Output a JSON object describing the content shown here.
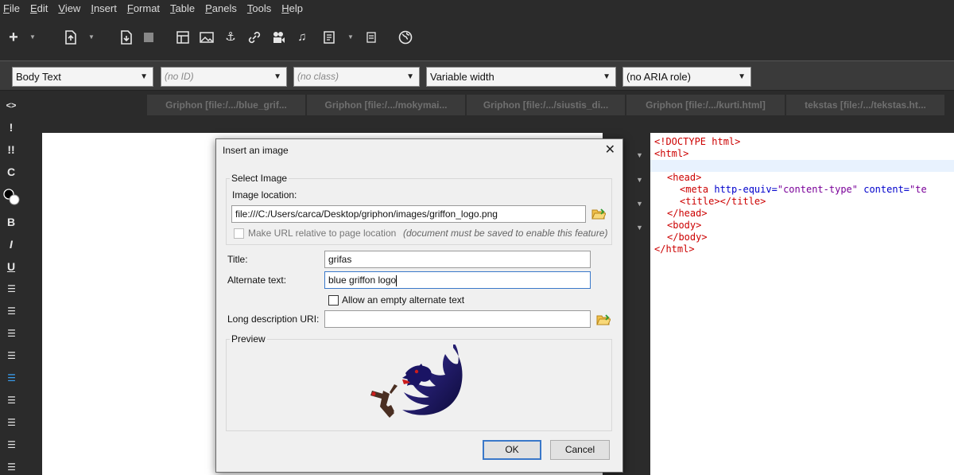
{
  "menu": [
    {
      "label": "File",
      "acc": "F",
      "rest": "ile"
    },
    {
      "label": "Edit",
      "acc": "E",
      "rest": "dit"
    },
    {
      "label": "View",
      "acc": "V",
      "rest": "iew"
    },
    {
      "label": "Insert",
      "acc": "I",
      "rest": "nsert"
    },
    {
      "label": "Format",
      "acc": "F",
      "rest": "ormat"
    },
    {
      "label": "Table",
      "acc": "T",
      "rest": "able"
    },
    {
      "label": "Panels",
      "acc": "P",
      "rest": "anels"
    },
    {
      "label": "Tools",
      "acc": "T",
      "rest": "ools"
    },
    {
      "label": "Help",
      "acc": "H",
      "rest": "elp"
    }
  ],
  "formatbar": {
    "paragraph_style": "Body Text",
    "id": "(no ID)",
    "class": "(no class)",
    "width": "Variable width",
    "aria": "(no ARIA role)"
  },
  "tabs": [
    "Griphon [file:/.../blue_grif...",
    "Griphon [file:/.../mokymai...",
    "Griphon [file:/.../siustis_di...",
    "Griphon [file:/.../kurti.html]",
    "tekstas [file:/.../tekstas.ht..."
  ],
  "source": {
    "doctype": "<!DOCTYPE html>",
    "html_open": "<html>",
    "head_open": "<head>",
    "meta_tag": "<meta",
    "meta_attr1": "http-equiv=",
    "meta_val1": "\"content-type\"",
    "meta_attr2": "content=",
    "meta_val2": "\"te",
    "title_tags": "<title></title>",
    "head_close": "</head>",
    "body_open": "<body>",
    "body_close": "</body>",
    "html_close": "</html>"
  },
  "dialog": {
    "title": "Insert an image",
    "select_image_legend": "Select Image",
    "image_location_label": "Image location:",
    "image_location_value": "file:///C:/Users/carca/Desktop/griphon/images/griffon_logo.png",
    "relative_label": "Make URL relative to page location",
    "relative_note": "(document must be saved to enable this feature)",
    "title_label": "Title:",
    "title_value": "grifas",
    "alt_label": "Alternate text:",
    "alt_value": "blue griffon logo",
    "allow_empty_label": "Allow an empty alternate text",
    "longdesc_label": "Long description URI:",
    "longdesc_value": "",
    "preview_legend": "Preview",
    "ok_label": "OK",
    "cancel_label": "Cancel"
  },
  "colors": {
    "accent": "#3a78c9",
    "tag_red": "#cc0000",
    "tag_blue": "#0000cc",
    "logo_navy": "#1a1464"
  }
}
